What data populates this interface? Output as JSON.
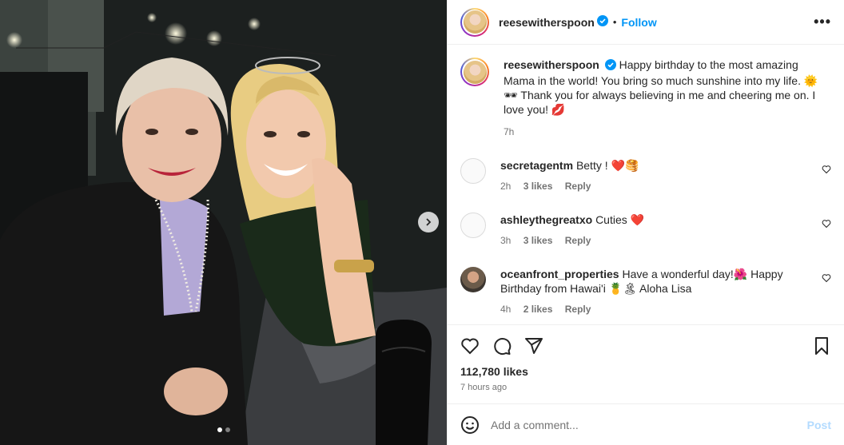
{
  "post": {
    "username": "reesewitherspoon",
    "follow_label": "Follow",
    "more_label": "•••",
    "separator": "•"
  },
  "caption": {
    "username": "reesewitherspoon",
    "text": "Happy birthday to the most amazing Mama in the world! You bring so much sunshine into my life. 🌞🕶 Thank you for always believing in me and cheering me on. I love you! 💋",
    "time": "7h"
  },
  "comments": [
    {
      "username": "secretagentm",
      "text": "Betty ! ❤️🥞",
      "time": "2h",
      "likes": "3 likes",
      "reply": "Reply"
    },
    {
      "username": "ashleythegreatxo",
      "text": "Cuties ❤️",
      "time": "3h",
      "likes": "3 likes",
      "reply": "Reply"
    },
    {
      "username": "oceanfront_properties",
      "text": "Have a wonderful day!🌺 Happy Birthday from Hawai'i 🍍🏝 Aloha Lisa",
      "time": "4h",
      "likes": "2 likes",
      "reply": "Reply"
    }
  ],
  "stats": {
    "likes": "112,780 likes",
    "time_ago": "7 hours ago"
  },
  "composer": {
    "placeholder": "Add a comment...",
    "post_label": "Post"
  },
  "carousel": {
    "total": 2,
    "current": 1
  },
  "colors": {
    "accent": "#0095f6",
    "verified": "#0095f6",
    "heart_red": "#ff3040"
  },
  "icons": [
    "verified-icon",
    "more-icon",
    "heart-icon",
    "comment-icon",
    "share-icon",
    "save-icon",
    "emoji-icon",
    "chevron-right-icon"
  ]
}
